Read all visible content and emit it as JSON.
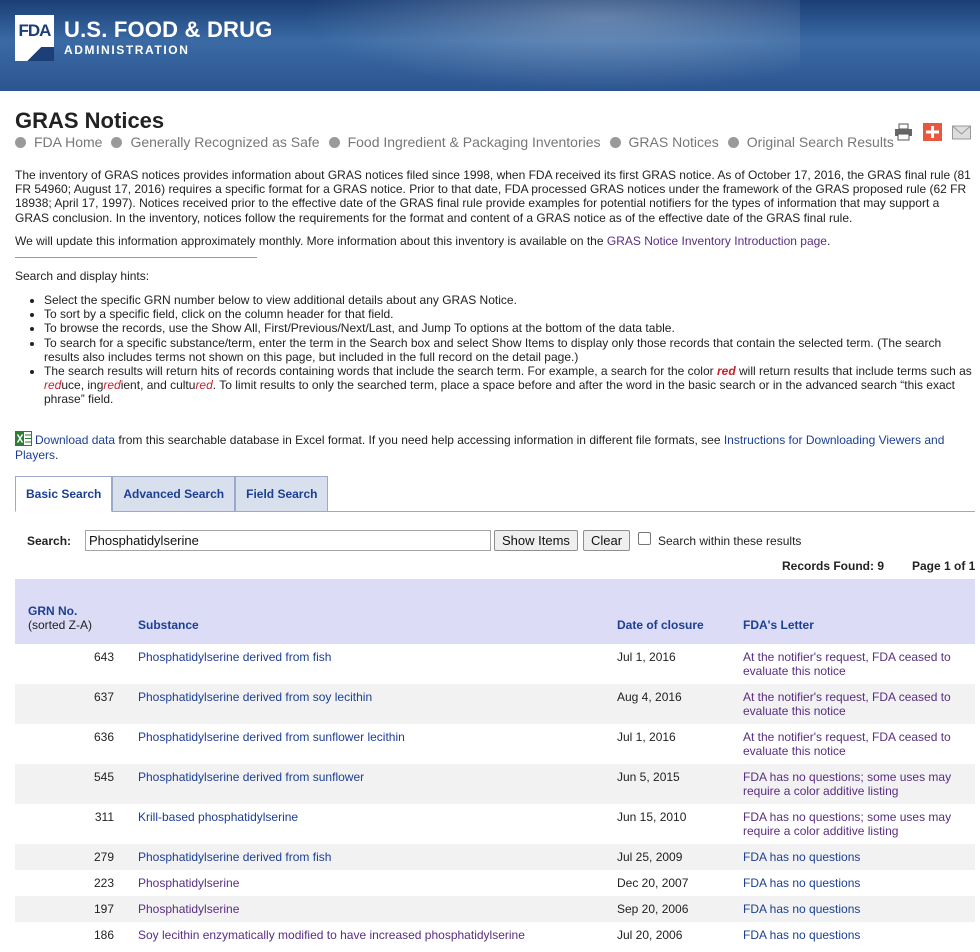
{
  "header": {
    "badge": "FDA",
    "brand_main": "U.S. FOOD & DRUG",
    "brand_sub": "ADMINISTRATION"
  },
  "page_title": "GRAS Notices",
  "breadcrumb": [
    "FDA Home",
    "Generally Recognized as Safe",
    "Food Ingredient & Packaging Inventories",
    "GRAS Notices",
    "Original Search Results"
  ],
  "tools": [
    "print-icon",
    "share-icon",
    "email-icon"
  ],
  "intro": "The inventory of GRAS notices provides information about GRAS notices filed since 1998, when FDA received its first GRAS notice. As of October 17, 2016, the GRAS final rule (81 FR 54960; August 17, 2016) requires a specific format for a GRAS notice. Prior to that date, FDA processed GRAS notices under the framework of the GRAS proposed rule (62 FR 18938; April 17, 1997). Notices received prior to the effective date of the GRAS final rule provide examples for potential notifiers for the types of information that may support a GRAS conclusion. In the inventory, notices follow the requirements for the format and content of a GRAS notice as of the effective date of the GRAS final rule.",
  "update": {
    "text": "We will update this information approximately monthly. More information about this inventory is available on the ",
    "link": "GRAS Notice Inventory Introduction page",
    "end": "."
  },
  "hints_title": "Search and display hints:",
  "hints": {
    "h1": "Select the specific GRN number below to view additional details about any GRAS Notice.",
    "h2": "To sort by a specific field, click on the column header for that field.",
    "h3": "To browse the records, use the Show All, First/Previous/Next/Last, and Jump To options at the bottom of the data table.",
    "h4": "To search for a specific substance/term, enter the term in the Search box and select Show Items to display only those records that contain the selected term. (The search results also includes terms not shown on this page, but included in the full record on the detail page.)",
    "h5_a": "The search results will return hits of records containing words that include the search term. For example, a search for the color ",
    "h5_red": "red",
    "h5_b": " will return results that include terms such as ",
    "h5_w1a": "red",
    "h5_w1b": "uce, ing",
    "h5_w2a": "red",
    "h5_w2b": "ient, and cultu",
    "h5_w3a": "red",
    "h5_c": ". To limit results to only the searched term, place a space before and after the word in the basic search or in the advanced search “this exact phrase” field."
  },
  "download": {
    "link": "Download data",
    "text": " from this searchable database in Excel format. If you need help accessing information in different file formats, see ",
    "link2": "Instructions for Downloading Viewers and Players",
    "end": "."
  },
  "tabs": [
    "Basic Search",
    "Advanced Search",
    "Field Search"
  ],
  "search": {
    "label": "Search:",
    "value": "Phosphatidylserine",
    "show_button": "Show Items",
    "clear_button": "Clear",
    "within_label": "Search within these results",
    "within_checked": false
  },
  "records_found": "Records Found: 9",
  "page_info": "Page 1 of 1",
  "table": {
    "headers": {
      "grn": "GRN No.",
      "grn_sort": "(sorted Z-A)",
      "substance": "Substance",
      "date": "Date of closure",
      "letter": "FDA's Letter"
    },
    "rows": [
      {
        "grn": "643",
        "substance": "Phosphatidylserine derived from fish",
        "date": "Jul 1, 2016",
        "letter": "At the notifier's request, FDA ceased to evaluate this notice"
      },
      {
        "grn": "637",
        "substance": "Phosphatidylserine derived from soy lecithin",
        "date": "Aug 4, 2016",
        "letter": "At the notifier's request, FDA ceased to evaluate this notice"
      },
      {
        "grn": "636",
        "substance": "Phosphatidylserine derived from sunflower lecithin",
        "date": "Jul 1, 2016",
        "letter": "At the notifier's request, FDA ceased to evaluate this notice"
      },
      {
        "grn": "545",
        "substance": "Phosphatidylserine derived from sunflower",
        "date": "Jun 5, 2015",
        "letter": "FDA has no questions; some uses may require a color additive listing"
      },
      {
        "grn": "311",
        "substance": "Krill-based phosphatidylserine",
        "date": "Jun 15, 2010",
        "letter": "FDA has no questions; some uses may require a color additive listing"
      },
      {
        "grn": "279",
        "substance": "Phosphatidylserine derived from fish",
        "date": "Jul 25, 2009",
        "letter": "FDA has no questions"
      },
      {
        "grn": "223",
        "substance": "Phosphatidylserine",
        "date": "Dec 20, 2007",
        "letter": "FDA has no questions"
      },
      {
        "grn": "197",
        "substance": "Phosphatidylserine",
        "date": "Sep 20, 2006",
        "letter": "FDA has no questions"
      },
      {
        "grn": "186",
        "substance": "Soy lecithin enzymatically modified to have increased phosphatidylserine",
        "date": "Jul 20, 2006",
        "letter": "FDA has no questions"
      }
    ]
  },
  "colors": {
    "header_blue": "#2c5590",
    "link_blue": "#1c3f94",
    "visited_purple": "#5a2d82",
    "table_header_bg": "#dcdcf6",
    "alt_row_bg": "#f2f2f2",
    "highlight_red": "#c9202a"
  }
}
